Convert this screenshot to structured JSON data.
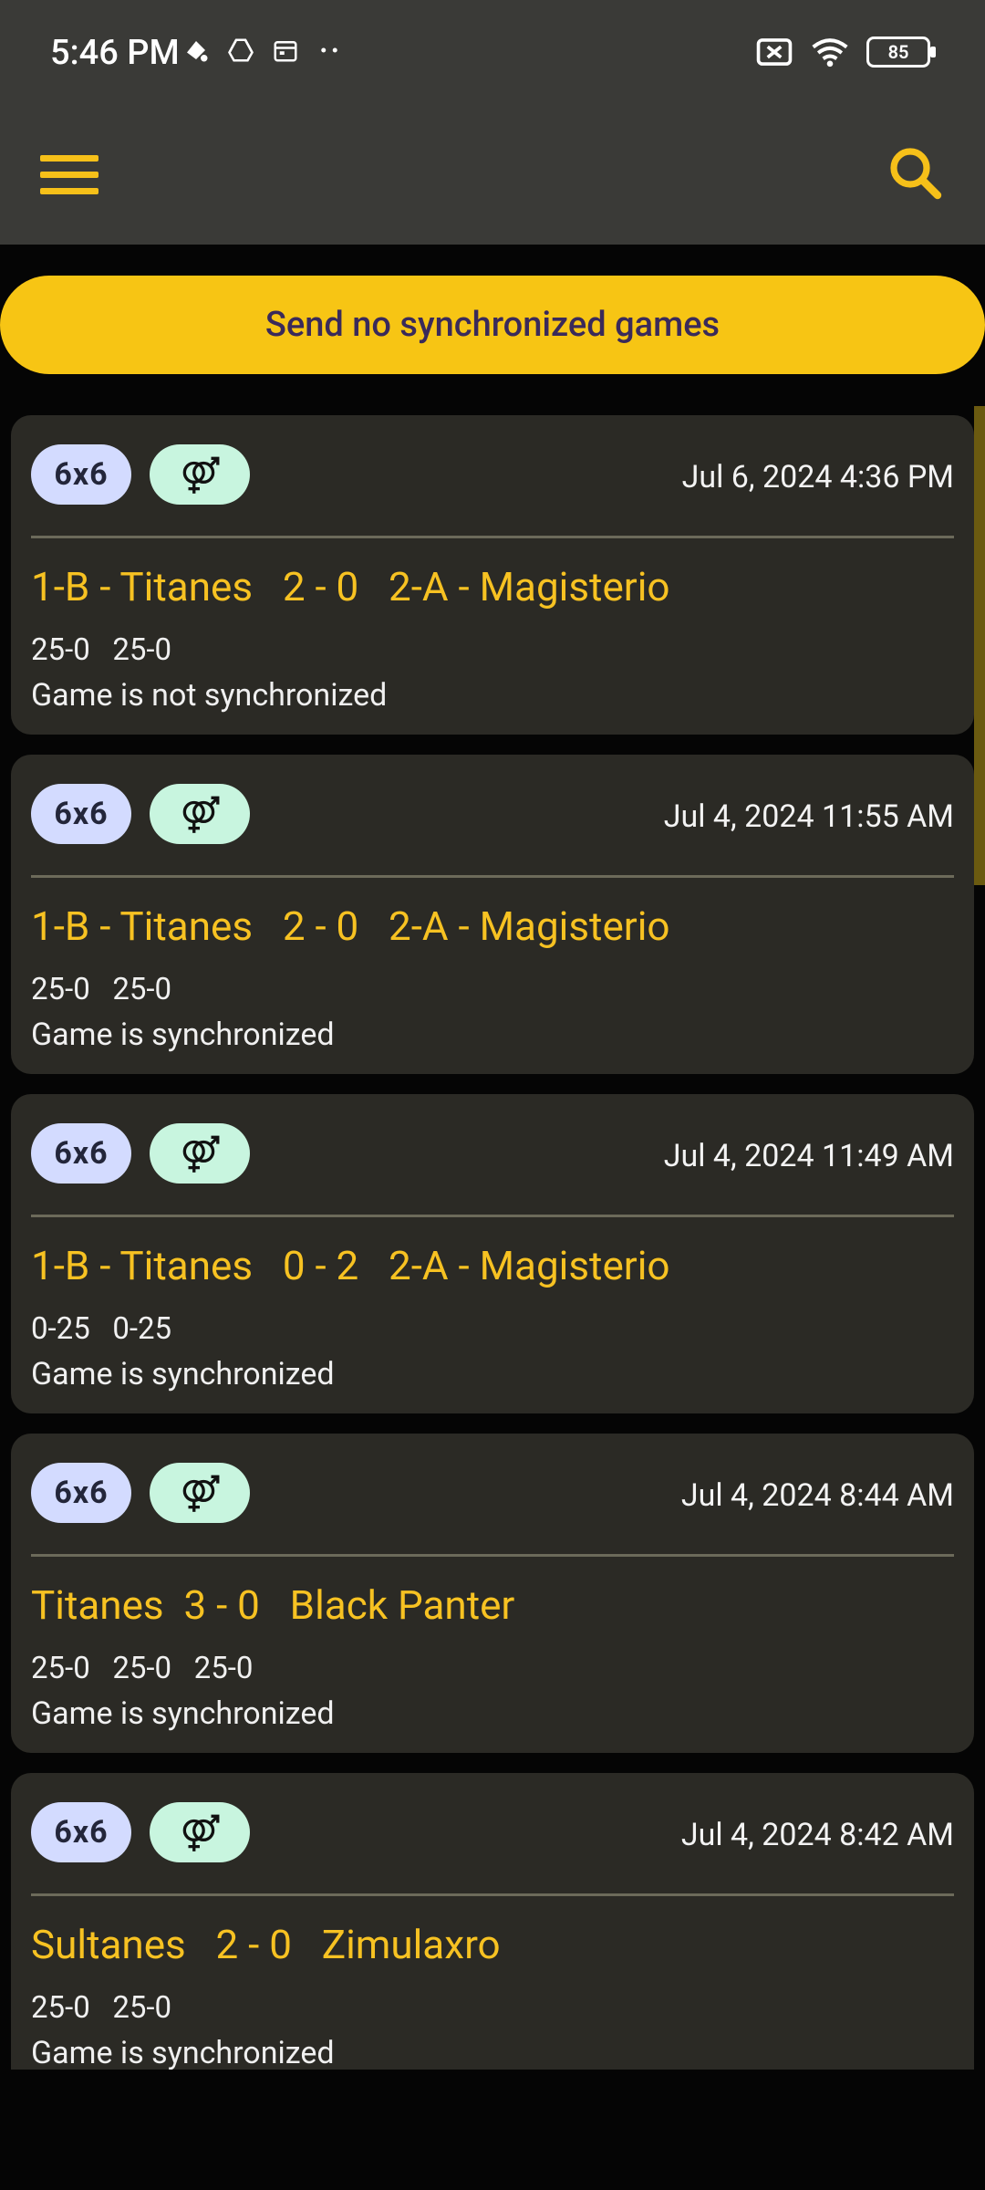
{
  "status_bar": {
    "time": "5:46 PM",
    "battery": "85"
  },
  "sync_button": {
    "label": "Send no synchronized games"
  },
  "games": [
    {
      "format": "6x6",
      "date": "Jul 6, 2024 4:36 PM",
      "team1": "1-B - Titanes",
      "score": "2 - 0",
      "team2": "2-A - Magisterio",
      "sets": [
        "25-0",
        "25-0"
      ],
      "status": "Game is not synchronized"
    },
    {
      "format": "6x6",
      "date": "Jul 4, 2024 11:55 AM",
      "team1": "1-B - Titanes",
      "score": "2 - 0",
      "team2": "2-A - Magisterio",
      "sets": [
        "25-0",
        "25-0"
      ],
      "status": "Game is synchronized"
    },
    {
      "format": "6x6",
      "date": "Jul 4, 2024 11:49 AM",
      "team1": "1-B - Titanes",
      "score": "0 - 2",
      "team2": "2-A - Magisterio",
      "sets": [
        "0-25",
        "0-25"
      ],
      "status": "Game is synchronized"
    },
    {
      "format": "6x6",
      "date": "Jul 4, 2024 8:44 AM",
      "team1": "Titanes",
      "score": "3 - 0",
      "team2": "Black Panter",
      "sets": [
        "25-0",
        "25-0",
        "25-0"
      ],
      "status": "Game is synchronized"
    },
    {
      "format": "6x6",
      "date": "Jul 4, 2024 8:42 AM",
      "team1": "Sultanes",
      "score": "2 - 0",
      "team2": "Zimulaxro",
      "sets": [
        "25-0",
        "25-0"
      ],
      "status": "Game is synchronized"
    }
  ]
}
